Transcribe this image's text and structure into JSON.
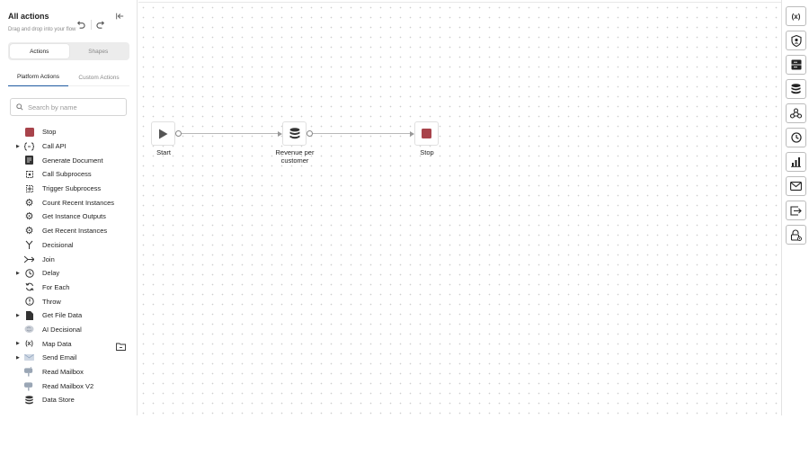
{
  "sidebar": {
    "title": "All actions",
    "subtitle": "Drag and drop into your flow",
    "segments": {
      "actions": "Actions",
      "shapes": "Shapes"
    },
    "tabs": {
      "platform": "Platform Actions",
      "custom": "Custom Actions"
    },
    "search_placeholder": "Search by name",
    "items": [
      {
        "label": "Stop",
        "icon": "stop-icon",
        "expandable": false
      },
      {
        "label": "Call API",
        "icon": "api-icon",
        "expandable": true
      },
      {
        "label": "Generate Document",
        "icon": "document-icon",
        "expandable": false
      },
      {
        "label": "Call Subprocess",
        "icon": "subprocess-icon",
        "expandable": false
      },
      {
        "label": "Trigger Subprocess",
        "icon": "trigger-subprocess-icon",
        "expandable": false
      },
      {
        "label": "Count Recent Instances",
        "icon": "gear-icon",
        "expandable": false
      },
      {
        "label": "Get Instance Outputs",
        "icon": "gear-icon",
        "expandable": false
      },
      {
        "label": "Get Recent Instances",
        "icon": "gear-icon",
        "expandable": false
      },
      {
        "label": "Decisional",
        "icon": "branch-icon",
        "expandable": false
      },
      {
        "label": "Join",
        "icon": "join-icon",
        "expandable": false
      },
      {
        "label": "Delay",
        "icon": "clock-icon",
        "expandable": true
      },
      {
        "label": "For Each",
        "icon": "loop-icon",
        "expandable": false
      },
      {
        "label": "Throw",
        "icon": "alert-icon",
        "expandable": false
      },
      {
        "label": "Get File Data",
        "icon": "file-icon",
        "expandable": true
      },
      {
        "label": "AI Decisional",
        "icon": "brain-icon",
        "expandable": false
      },
      {
        "label": "Map Data",
        "icon": "variable-icon",
        "expandable": true
      },
      {
        "label": "Send Email",
        "icon": "email-icon",
        "expandable": true
      },
      {
        "label": "Read Mailbox",
        "icon": "mailbox-icon",
        "expandable": false
      },
      {
        "label": "Read Mailbox V2",
        "icon": "mailbox-icon",
        "expandable": false
      },
      {
        "label": "Data Store",
        "icon": "database-icon",
        "expandable": false
      }
    ]
  },
  "flow": {
    "nodes": [
      {
        "label": "Start",
        "icon": "play-icon"
      },
      {
        "label": "Revenue per customer",
        "icon": "database-icon"
      },
      {
        "label": "Stop",
        "icon": "stop-icon"
      }
    ]
  },
  "right_toolbar": {
    "buttons": [
      {
        "name": "variables-button",
        "icon": "variable-icon",
        "glyph": "(x)"
      },
      {
        "name": "security-button",
        "icon": "shield-user-icon"
      },
      {
        "name": "server-button",
        "icon": "server-icon"
      },
      {
        "name": "database-button",
        "icon": "database-icon"
      },
      {
        "name": "webhook-button",
        "icon": "webhook-icon"
      },
      {
        "name": "schedule-button",
        "icon": "clock-icon"
      },
      {
        "name": "analytics-button",
        "icon": "chart-icon"
      },
      {
        "name": "email-button",
        "icon": "email-icon"
      },
      {
        "name": "export-button",
        "icon": "export-icon"
      },
      {
        "name": "lock-button",
        "icon": "lock-gear-icon"
      }
    ]
  },
  "colors": {
    "stop_red": "#a8434b",
    "accent_blue": "#1e5aa0"
  }
}
